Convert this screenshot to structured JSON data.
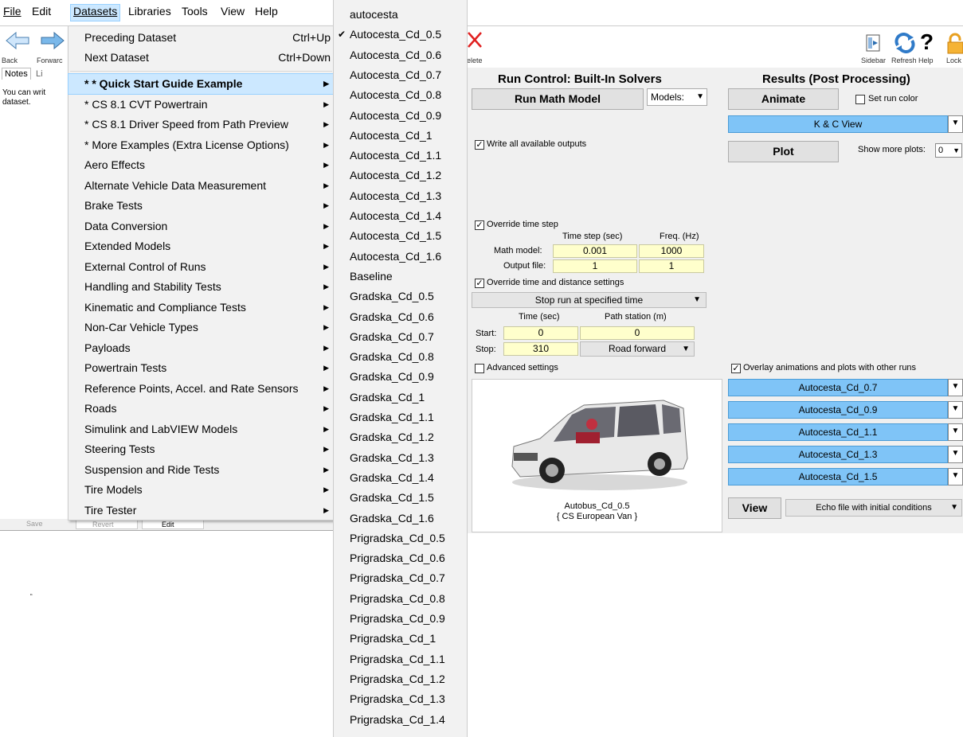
{
  "menubar": {
    "items": [
      "File",
      "Edit",
      "Datasets",
      "Libraries",
      "Tools",
      "View",
      "Help"
    ]
  },
  "toolbar": {
    "back_label": "Back",
    "forward_label": "Forwarc",
    "delete_label": "elete",
    "sidebar_label": "Sidebar",
    "refresh_label": "Refresh",
    "help_label": "Help",
    "lock_label": "Lock"
  },
  "leftpane": {
    "tab_notes": "Notes",
    "tab_li": "Li",
    "note_line1": "You can writ",
    "note_line2": "dataset.",
    "save_label": "Save",
    "revert_label": "Revert",
    "edit_label": "Edit",
    "small_mark": "“"
  },
  "datasets_menu": {
    "preceding": "Preceding Dataset",
    "preceding_accel": "Ctrl+Up",
    "next": "Next Dataset",
    "next_accel": "Ctrl+Down",
    "items": [
      "* * Quick Start Guide Example",
      "* CS 8.1 CVT Powertrain",
      "* CS 8.1 Driver Speed from Path Preview",
      "* More Examples (Extra License Options)",
      "Aero Effects",
      "Alternate Vehicle Data Measurement",
      "Brake Tests",
      "Data Conversion",
      "Extended Models",
      "External Control of Runs",
      "Handling and Stability Tests",
      "Kinematic and Compliance Tests",
      "Non-Car Vehicle Types",
      "Payloads",
      "Powertrain Tests",
      "Reference Points, Accel. and Rate Sensors",
      "Roads",
      "Simulink and LabVIEW Models",
      "Steering Tests",
      "Suspension and Ride Tests",
      "Tire Models",
      "Tire Tester"
    ]
  },
  "submenu": {
    "checked_index": 1,
    "items": [
      "autocesta",
      "Autocesta_Cd_0.5",
      "Autocesta_Cd_0.6",
      "Autocesta_Cd_0.7",
      "Autocesta_Cd_0.8",
      "Autocesta_Cd_0.9",
      "Autocesta_Cd_1",
      "Autocesta_Cd_1.1",
      "Autocesta_Cd_1.2",
      "Autocesta_Cd_1.3",
      "Autocesta_Cd_1.4",
      "Autocesta_Cd_1.5",
      "Autocesta_Cd_1.6",
      "Baseline",
      "Gradska_Cd_0.5",
      "Gradska_Cd_0.6",
      "Gradska_Cd_0.7",
      "Gradska_Cd_0.8",
      "Gradska_Cd_0.9",
      "Gradska_Cd_1",
      "Gradska_Cd_1.1",
      "Gradska_Cd_1.2",
      "Gradska_Cd_1.3",
      "Gradska_Cd_1.4",
      "Gradska_Cd_1.5",
      "Gradska_Cd_1.6",
      "Prigradska_Cd_0.5",
      "Prigradska_Cd_0.6",
      "Prigradska_Cd_0.7",
      "Prigradska_Cd_0.8",
      "Prigradska_Cd_0.9",
      "Prigradska_Cd_1",
      "Prigradska_Cd_1.1",
      "Prigradska_Cd_1.2",
      "Prigradska_Cd_1.3",
      "Prigradska_Cd_1.4"
    ]
  },
  "run_control": {
    "title": "Run Control: Built-In Solvers",
    "run_button": "Run Math Model",
    "models_label": "Models:",
    "write_outputs": "Write all available outputs",
    "override_step": "Override time step",
    "col_timestep": "Time step (sec)",
    "col_freq": "Freq. (Hz)",
    "math_model_label": "Math model:",
    "math_model_step": "0.001",
    "math_model_freq": "1000",
    "output_file_label": "Output file:",
    "output_file_step": "1",
    "output_file_freq": "1",
    "override_time_dist": "Override time and distance settings",
    "stop_mode": "Stop run at specified time",
    "col_time": "Time (sec)",
    "col_station": "Path station (m)",
    "start_label": "Start:",
    "start_time": "0",
    "start_station": "0",
    "stop_label": "Stop:",
    "stop_time": "310",
    "road_dir": "Road forward",
    "advanced": "Advanced settings",
    "vehicle_name": "Autobus_Cd_0.5",
    "vehicle_type": "{ CS European Van }"
  },
  "results": {
    "title": "Results (Post Processing)",
    "animate_button": "Animate",
    "set_run_color": "Set run color",
    "view_select": "K & C View",
    "plot_button": "Plot",
    "show_more_plots": "Show more plots:",
    "show_more_value": "0",
    "overlay_label": "Overlay animations and plots with other runs",
    "overlay_runs": [
      "Autocesta_Cd_0.7",
      "Autocesta_Cd_0.9",
      "Autocesta_Cd_1.1",
      "Autocesta_Cd_1.3",
      "Autocesta_Cd_1.5"
    ],
    "view_button": "View",
    "echo_select": "Echo file with initial conditions"
  },
  "colors": {
    "selection_bg": "#cce8ff",
    "blue_dropdown": "#7fc4f7",
    "input_bg": "#ffffcc",
    "delete_red": "#e02020"
  }
}
